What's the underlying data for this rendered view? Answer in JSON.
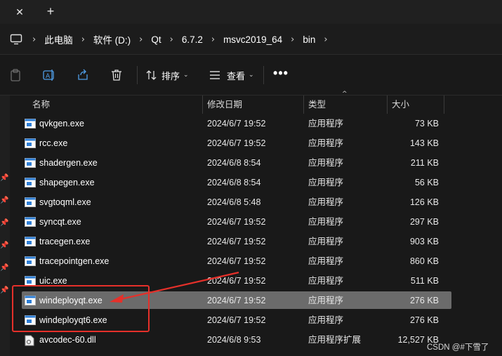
{
  "tabbar": {
    "close_glyph": "✕",
    "new_glyph": "+"
  },
  "address": {
    "icon": "pc-icon",
    "separator": "›",
    "crumbs": [
      "此电脑",
      "软件 (D:)",
      "Qt",
      "6.7.2",
      "msvc2019_64",
      "bin"
    ]
  },
  "toolbar": {
    "icons": [
      "paste-icon",
      "rename-icon",
      "share-icon",
      "delete-icon"
    ],
    "sort_label": "排序",
    "view_label": "查看",
    "more_label": "•••",
    "caret": "⌄"
  },
  "columns": {
    "name": "名称",
    "date": "修改日期",
    "type": "类型",
    "size": "大小",
    "sort_caret": "^"
  },
  "files": [
    {
      "name": "qvkgen.exe",
      "date": "2024/6/7 19:52",
      "type": "应用程序",
      "size": "73 KB",
      "icon": "exe-icon"
    },
    {
      "name": "rcc.exe",
      "date": "2024/6/7 19:52",
      "type": "应用程序",
      "size": "143 KB",
      "icon": "exe-icon"
    },
    {
      "name": "shadergen.exe",
      "date": "2024/6/8 8:54",
      "type": "应用程序",
      "size": "211 KB",
      "icon": "exe-icon"
    },
    {
      "name": "shapegen.exe",
      "date": "2024/6/8 8:54",
      "type": "应用程序",
      "size": "56 KB",
      "icon": "exe-icon"
    },
    {
      "name": "svgtoqml.exe",
      "date": "2024/6/8 5:48",
      "type": "应用程序",
      "size": "126 KB",
      "icon": "exe-icon"
    },
    {
      "name": "syncqt.exe",
      "date": "2024/6/7 19:52",
      "type": "应用程序",
      "size": "297 KB",
      "icon": "exe-icon"
    },
    {
      "name": "tracegen.exe",
      "date": "2024/6/7 19:52",
      "type": "应用程序",
      "size": "903 KB",
      "icon": "exe-icon"
    },
    {
      "name": "tracepointgen.exe",
      "date": "2024/6/7 19:52",
      "type": "应用程序",
      "size": "860 KB",
      "icon": "exe-icon"
    },
    {
      "name": "uic.exe",
      "date": "2024/6/7 19:52",
      "type": "应用程序",
      "size": "511 KB",
      "icon": "exe-icon"
    },
    {
      "name": "windeployqt.exe",
      "date": "2024/6/7 19:52",
      "type": "应用程序",
      "size": "276 KB",
      "icon": "exe-icon",
      "selected": true
    },
    {
      "name": "windeployqt6.exe",
      "date": "2024/6/7 19:52",
      "type": "应用程序",
      "size": "276 KB",
      "icon": "exe-icon"
    },
    {
      "name": "avcodec-60.dll",
      "date": "2024/6/8 9:53",
      "type": "应用程序扩展",
      "size": "12,527 KB",
      "icon": "dll-icon"
    }
  ],
  "annotation": {
    "color": "#e5302a"
  },
  "watermark": "CSDN @#下雪了",
  "colors": {
    "background": "#191919",
    "selected_row": "#6b6b6b",
    "annotation": "#e5302a",
    "exe_icon_blue": "#2f7fd6"
  }
}
